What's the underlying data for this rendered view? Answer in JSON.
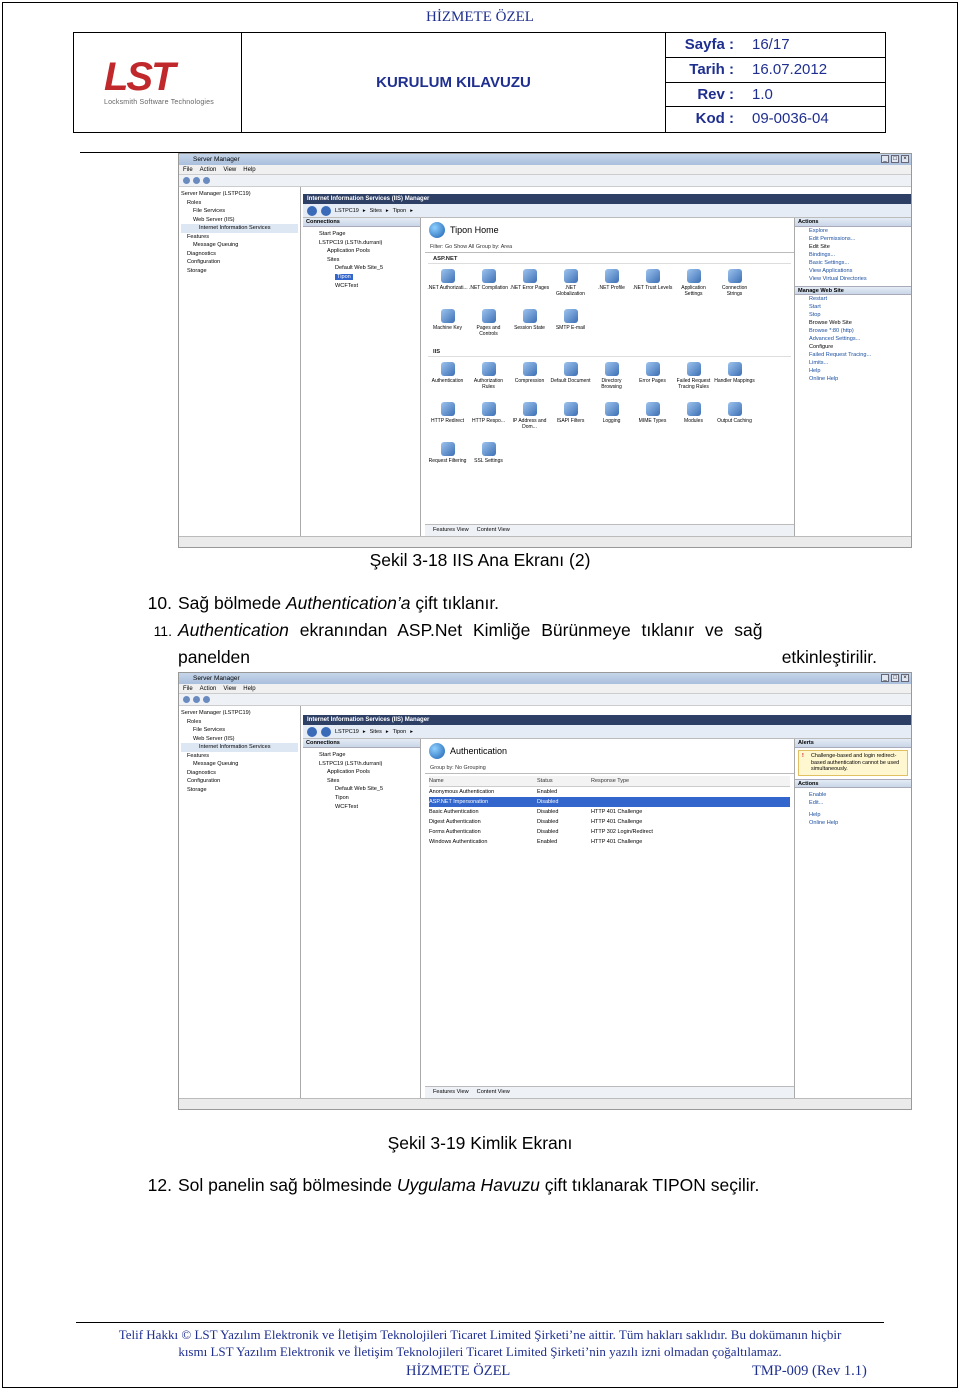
{
  "header": {
    "confidential_top": "HİZMETE ÖZEL",
    "logo_text": "LST",
    "logo_subtitle": "Locksmith Software Technologies",
    "doc_title": "KURULUM KILAVUZU",
    "meta": [
      {
        "key": "Sayfa :",
        "value": "16/17"
      },
      {
        "key": "Tarih :",
        "value": "16.07.2012"
      },
      {
        "key": "Rev :",
        "value": "1.0"
      },
      {
        "key": "Kod :",
        "value": "09-0036-04"
      }
    ]
  },
  "screenshot1": {
    "window_title": "Server Manager",
    "menu": [
      "File",
      "Action",
      "View",
      "Help"
    ],
    "tree": [
      "Server Manager (LSTPC19)",
      "Roles",
      "File Services",
      "Web Server (IIS)",
      "Internet Information Services",
      "Features",
      "Message Queuing",
      "Diagnostics",
      "Configuration",
      "Storage"
    ],
    "iis_title": "Internet Information Services (IIS) Manager",
    "address": [
      "LSTPC19",
      "Sites",
      "Tipon"
    ],
    "connections_label": "Connections",
    "connections": [
      "Start Page",
      "LSTPC19 (LST\\h.durrani)",
      "Application Pools",
      "Sites",
      "Default Web Site_5",
      "Tipon",
      "WCFTest"
    ],
    "home_title": "Tipon Home",
    "filter_text": "Filter:          Go  Show All  Group by: Area",
    "group_aspnet": "ASP.NET",
    "aspnet_icons": [
      ".NET Authorizati...",
      ".NET Compilation",
      ".NET Error Pages",
      ".NET Globalization",
      ".NET Profile",
      ".NET Trust Levels",
      "Application Settings",
      "Connection Strings",
      "Machine Key",
      "Pages and Controls",
      "Session State",
      "SMTP E-mail"
    ],
    "group_iis": "IIS",
    "iis_icons": [
      "Authentication",
      "Authorization Rules",
      "Compression",
      "Default Document",
      "Directory Browsing",
      "Error Pages",
      "Failed Request Tracing Rules",
      "Handler Mappings",
      "HTTP Redirect",
      "HTTP Respo...",
      "IP Address and Dom...",
      "ISAPI Filters",
      "Logging",
      "MIME Types",
      "Modules",
      "Output Caching",
      "Request Filtering",
      "SSL Settings"
    ],
    "tabs": [
      "Features View",
      "Content View"
    ],
    "actions_label": "Actions",
    "actions": [
      "Explore",
      "Edit Permissions...",
      "Edit Site",
      "Bindings...",
      "Basic Settings...",
      "View Applications",
      "View Virtual Directories"
    ],
    "manage_label": "Manage Web Site",
    "manage": [
      "Restart",
      "Start",
      "Stop"
    ],
    "browse_label": "Browse Web Site",
    "browse": [
      "Browse *:80 (http)",
      "Advanced Settings..."
    ],
    "configure_label": "Configure",
    "configure": [
      "Failed Request Tracing...",
      "Limits...",
      "Help",
      "Online Help"
    ]
  },
  "caption1": "Şekil 3-18 IIS Ana Ekranı (2)",
  "step10": {
    "num": "10.",
    "pre": "Sağ bölmede ",
    "italic": "Authentication’a",
    "post": " çift tıklanır."
  },
  "step11": {
    "num": "11.",
    "italic": "Authentication",
    "line1_rest": " ekranından ASP.Net Kimliğe Bürünmeye tıklanır ve sağ",
    "line2_left": "panelden",
    "line2_right": "etkinleştirilir."
  },
  "screenshot2": {
    "window_title": "Server Manager",
    "menu": [
      "File",
      "Action",
      "View",
      "Help"
    ],
    "tree": [
      "Server Manager (LSTPC19)",
      "Roles",
      "File Services",
      "Web Server (IIS)",
      "Internet Information Services",
      "Features",
      "Message Queuing",
      "Diagnostics",
      "Configuration",
      "Storage"
    ],
    "iis_title": "Internet Information Services (IIS) Manager",
    "address": [
      "LSTPC19",
      "Sites",
      "Tipon"
    ],
    "connections_label": "Connections",
    "connections": [
      "Start Page",
      "LSTPC19 (LST\\h.durrani)",
      "Application Pools",
      "Sites",
      "Default Web Site_5",
      "Tipon",
      "WCFTest"
    ],
    "auth_title": "Authentication",
    "group_by": "Group by:   No Grouping",
    "columns": [
      "Name",
      "Status",
      "Response Type"
    ],
    "rows": [
      [
        "Anonymous Authentication",
        "Enabled",
        ""
      ],
      [
        "ASP.NET Impersonation",
        "Disabled",
        ""
      ],
      [
        "Basic Authentication",
        "Disabled",
        "HTTP 401 Challenge"
      ],
      [
        "Digest Authentication",
        "Disabled",
        "HTTP 401 Challenge"
      ],
      [
        "Forms Authentication",
        "Disabled",
        "HTTP 302 Login/Redirect"
      ],
      [
        "Windows Authentication",
        "Enabled",
        "HTTP 401 Challenge"
      ]
    ],
    "alerts_label": "Alerts",
    "alert_text": "Challenge-based and login redirect-based authentication cannot be used simultaneously.",
    "actions_label": "Actions",
    "actions": [
      "Enable",
      "Edit...",
      "Help",
      "Online Help"
    ],
    "tabs": [
      "Features View",
      "Content View"
    ]
  },
  "caption2": "Şekil 3-19 Kimlik Ekranı",
  "step12": {
    "num": "12.",
    "pre": "Sol panelin sağ bölmesinde ",
    "italic": "Uygulama Havuzu",
    "post": " çift tıklanarak TIPON seçilir."
  },
  "footer": {
    "line1": "Telif Hakkı © LST Yazılım Elektronik ve İletişim Teknolojileri Ticaret Limited Şirketi’ne aittir. Tüm hakları saklıdır. Bu dokümanın hiçbir",
    "line2": "kısmı LST Yazılım Elektronik ve İletişim Teknolojileri Ticaret Limited Şirketi’nin yazılı izni olmadan çoğaltılamaz.",
    "confidential": "HİZMETE ÖZEL",
    "template": "TMP-009 (Rev 1.1)"
  }
}
